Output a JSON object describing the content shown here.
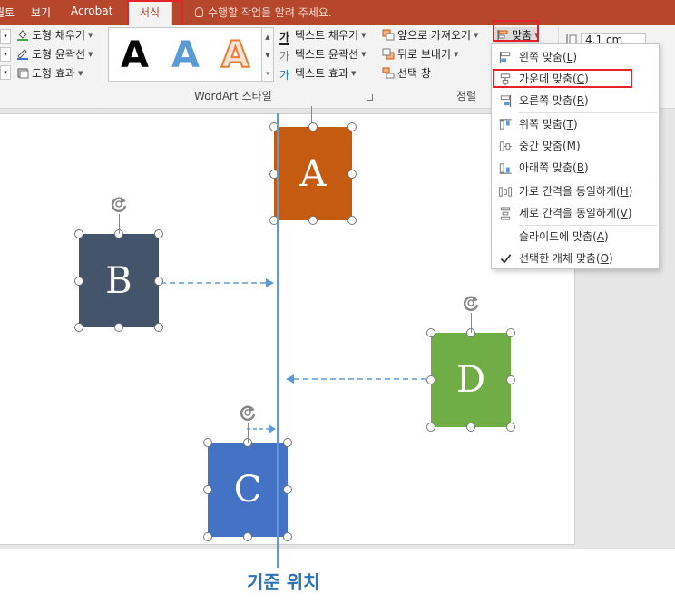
{
  "tabs": [
    {
      "label": "뭘토"
    },
    {
      "label": "보기"
    },
    {
      "label": "Acrobat"
    },
    {
      "label": "서식",
      "active": true
    }
  ],
  "tell_me": "수행할 작업을 알려 주세요.",
  "shape_styles": {
    "fill": "도형 채우기",
    "outline": "도형 윤곽선",
    "effects": "도형 효과"
  },
  "wordart": {
    "group_label": "WordArt 스타일",
    "samples": [
      {
        "glyph": "A",
        "style": "black"
      },
      {
        "glyph": "A",
        "style": "blue-gradient"
      },
      {
        "glyph": "A",
        "style": "orange-outline"
      }
    ],
    "text_fill": "텍스트 채우기",
    "text_outline": "텍스트 윤곽선",
    "text_effects": "텍스트 효과"
  },
  "arrange": {
    "group_label": "정렬",
    "bring_forward": "앞으로 가져오기",
    "send_backward": "뒤로 보내기",
    "selection_pane": "선택 창",
    "align_button": "맞춤"
  },
  "size": {
    "height_value": "4.1 cm"
  },
  "align_menu": {
    "items": [
      {
        "label": "왼쪽 맞춤",
        "key": "L",
        "icon": "align-left-icon"
      },
      {
        "label": "가운데 맞춤",
        "key": "C",
        "icon": "align-center-icon",
        "highlighted": true
      },
      {
        "label": "오른쪽 맞춤",
        "key": "R",
        "icon": "align-right-icon"
      },
      {
        "label": "위쪽 맞춤",
        "key": "T",
        "icon": "align-top-icon"
      },
      {
        "label": "중간 맞춤",
        "key": "M",
        "icon": "align-middle-icon"
      },
      {
        "label": "아래쪽 맞춤",
        "key": "B",
        "icon": "align-bottom-icon"
      },
      {
        "label": "가로 간격을 동일하게",
        "key": "H",
        "icon": "distribute-horizontal-icon"
      },
      {
        "label": "세로 간격을 동일하게",
        "key": "V",
        "icon": "distribute-vertical-icon"
      },
      {
        "label": "슬라이드에 맞춤",
        "key": "A",
        "icon": ""
      },
      {
        "label": "선택한 개체 맞춤",
        "key": "O",
        "icon": "checkmark-icon",
        "checked": true
      }
    ]
  },
  "slide": {
    "shapes": [
      {
        "id": "A",
        "label": "A",
        "color": "#c55a11"
      },
      {
        "id": "B",
        "label": "B",
        "color": "#44546a"
      },
      {
        "id": "C",
        "label": "C",
        "color": "#4472c4"
      },
      {
        "id": "D",
        "label": "D",
        "color": "#70ad47"
      }
    ],
    "reference_label": "기준 위치"
  },
  "colors": {
    "title_bar": "#b7472a",
    "highlight_box": "#e2242a",
    "reference_line": "#5b9bd5",
    "reference_text": "#2f73b7"
  }
}
